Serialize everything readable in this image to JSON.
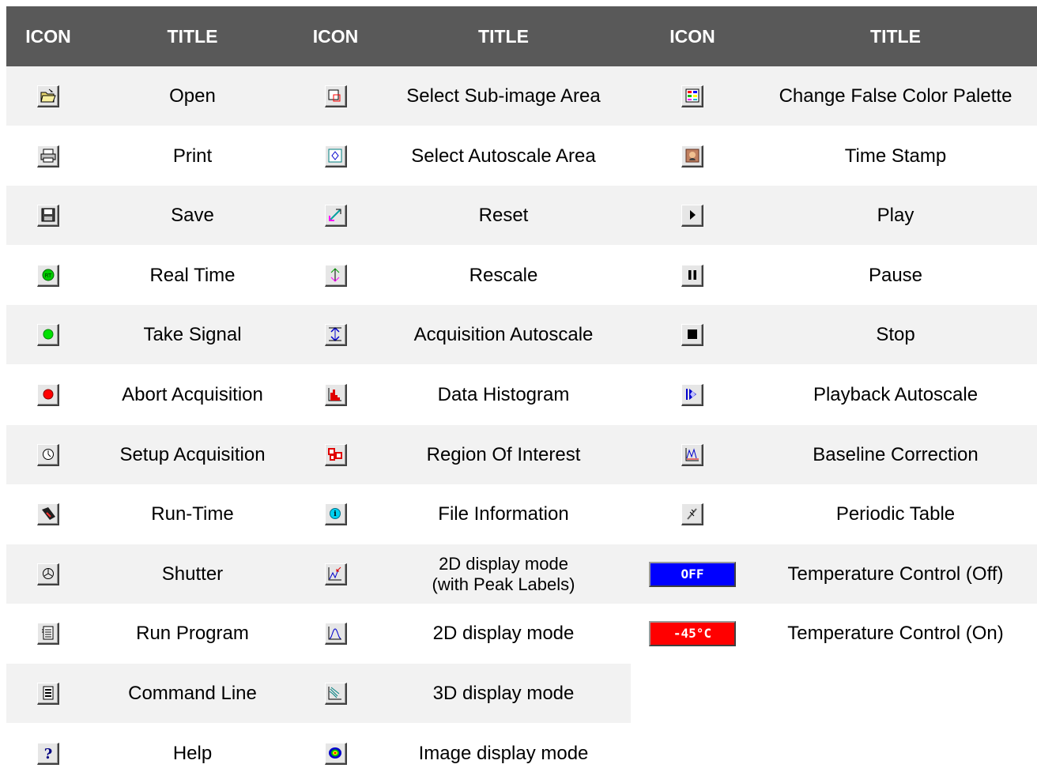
{
  "header": [
    "ICON",
    "TITLE",
    "ICON",
    "TITLE",
    "ICON",
    "TITLE"
  ],
  "columns": [
    {
      "rows": [
        {
          "icon": "open-folder-icon",
          "title": "Open"
        },
        {
          "icon": "printer-icon",
          "title": "Print"
        },
        {
          "icon": "floppy-disk-icon",
          "title": "Save"
        },
        {
          "icon": "real-time-icon",
          "title": "Real Time"
        },
        {
          "icon": "green-dot-icon",
          "title": "Take Signal"
        },
        {
          "icon": "red-dot-icon",
          "title": "Abort Acquisition"
        },
        {
          "icon": "clock-icon",
          "title": "Setup Acquisition"
        },
        {
          "icon": "run-time-icon",
          "title": "Run-Time"
        },
        {
          "icon": "shutter-icon",
          "title": "Shutter"
        },
        {
          "icon": "program-list-icon",
          "title": "Run Program"
        },
        {
          "icon": "command-line-icon",
          "title": "Command Line"
        },
        {
          "icon": "help-question-icon",
          "title": "Help"
        }
      ]
    },
    {
      "rows": [
        {
          "icon": "sub-image-select-icon",
          "title": "Select Sub-image Area"
        },
        {
          "icon": "autoscale-area-icon",
          "title": "Select Autoscale Area"
        },
        {
          "icon": "reset-arrow-icon",
          "title": "Reset"
        },
        {
          "icon": "rescale-icon",
          "title": "Rescale"
        },
        {
          "icon": "acquisition-autoscale-icon",
          "title": "Acquisition Autoscale"
        },
        {
          "icon": "histogram-icon",
          "title": "Data Histogram"
        },
        {
          "icon": "region-of-interest-icon",
          "title": "Region Of Interest"
        },
        {
          "icon": "info-icon",
          "title": "File Information"
        },
        {
          "icon": "peak-labels-graph-icon",
          "title": "2D display mode",
          "title2": "(with Peak Labels)"
        },
        {
          "icon": "graph-2d-icon",
          "title": "2D display mode"
        },
        {
          "icon": "graph-3d-icon",
          "title": "3D display mode"
        },
        {
          "icon": "image-display-icon",
          "title": "Image display mode"
        }
      ]
    },
    {
      "rows": [
        {
          "icon": "false-color-palette-icon",
          "title": "Change False Color Palette"
        },
        {
          "icon": "time-stamp-icon",
          "title": "Time Stamp"
        },
        {
          "icon": "play-icon",
          "title": "Play"
        },
        {
          "icon": "pause-icon",
          "title": "Pause"
        },
        {
          "icon": "stop-icon",
          "title": "Stop"
        },
        {
          "icon": "playback-autoscale-icon",
          "title": "Playback Autoscale"
        },
        {
          "icon": "baseline-correction-icon",
          "title": "Baseline Correction"
        },
        {
          "icon": "periodic-table-icon",
          "title": "Periodic Table"
        },
        {
          "icon": "temperature-off-indicator",
          "title": "Temperature Control (Off)",
          "badge": "OFF",
          "badge_color": "#0000ff"
        },
        {
          "icon": "temperature-on-indicator",
          "title": "Temperature Control (On)",
          "badge": "-45°C",
          "badge_color": "#ff0000"
        }
      ]
    }
  ],
  "colors": {
    "header_bg": "#595959",
    "header_text": "#ffffff",
    "stripe": "#f2f2f2"
  }
}
